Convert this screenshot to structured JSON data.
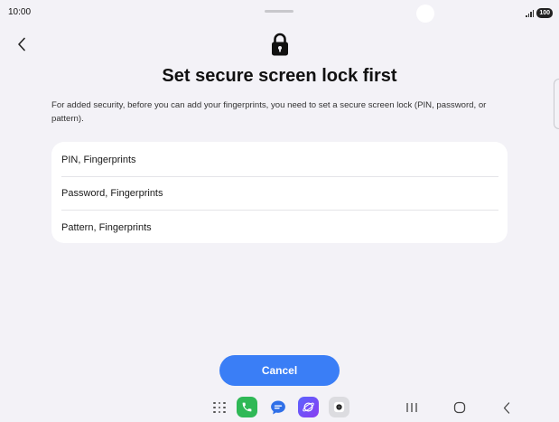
{
  "status_bar": {
    "time": "10:00",
    "battery_level": "100"
  },
  "header": {
    "back_icon": "chevron-left-icon",
    "lock_icon": "lock-icon",
    "title": "Set secure screen lock first"
  },
  "description": "For added security, before you can add your fingerprints, you need to set a secure screen lock (PIN, password, or pattern).",
  "options": [
    {
      "label": "PIN, Fingerprints"
    },
    {
      "label": "Password, Fingerprints"
    },
    {
      "label": "Pattern, Fingerprints"
    }
  ],
  "actions": {
    "cancel_label": "Cancel",
    "cancel_color": "#3a7ef6"
  },
  "nav_bar": {
    "apps": [
      "apps-grid-icon",
      "phone-app-icon",
      "messages-app-icon",
      "internet-app-icon",
      "camera-app-icon"
    ],
    "buttons": [
      "recents-icon",
      "home-icon",
      "back-icon"
    ]
  },
  "colors": {
    "background": "#f3f2f7",
    "card": "#ffffff",
    "accent": "#3a7ef6"
  }
}
